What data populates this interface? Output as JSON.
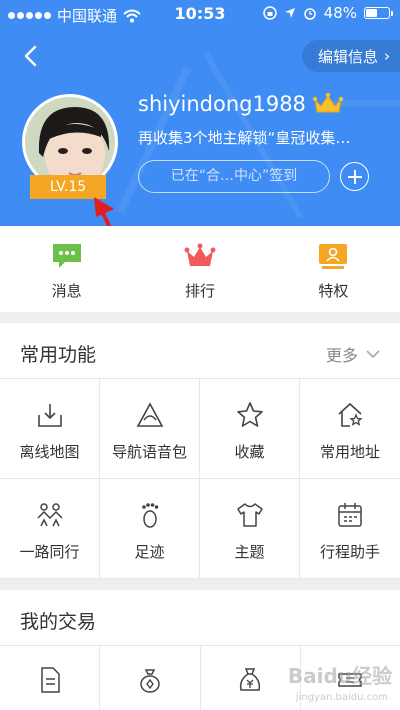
{
  "status_bar": {
    "carrier": "中国联通",
    "time": "10:53",
    "battery": "48%",
    "battery_level": 0.48
  },
  "header": {
    "edit_label": "编辑信息",
    "edit_chevron": "›",
    "username": "shiyindong1988",
    "unlock_text": "再收集3个地主解锁“皇冠收集…",
    "checkin_text": "已在“合…中心”签到",
    "level": "LV.15"
  },
  "quick_tabs": [
    {
      "label": "消息",
      "icon": "message-icon"
    },
    {
      "label": "排行",
      "icon": "crown-icon"
    },
    {
      "label": "特权",
      "icon": "privilege-icon"
    }
  ],
  "common": {
    "title": "常用功能",
    "more_label": "更多",
    "items": [
      {
        "label": "离线地图",
        "icon": "offline-map-icon"
      },
      {
        "label": "导航语音包",
        "icon": "voice-pack-icon"
      },
      {
        "label": "收藏",
        "icon": "star-icon"
      },
      {
        "label": "常用地址",
        "icon": "home-star-icon"
      },
      {
        "label": "一路同行",
        "icon": "companions-icon"
      },
      {
        "label": "足迹",
        "icon": "footprint-icon"
      },
      {
        "label": "主题",
        "icon": "tshirt-icon"
      },
      {
        "label": "行程助手",
        "icon": "calendar-icon"
      }
    ]
  },
  "trade": {
    "title": "我的交易",
    "items": [
      {
        "icon": "document-icon"
      },
      {
        "icon": "coin-bag-icon"
      },
      {
        "icon": "money-bag-icon"
      },
      {
        "icon": "ticket-icon"
      }
    ]
  },
  "watermark": {
    "main": "Baidu经验",
    "sub": "jingyan.baidu.com"
  },
  "colors": {
    "header_blue": "#3f8cf4",
    "badge_orange": "#f5a623",
    "message_green": "#6cc04a",
    "rank_red": "#f25a5a",
    "privilege_orange": "#f5a623",
    "arrow_red": "#e02020"
  }
}
